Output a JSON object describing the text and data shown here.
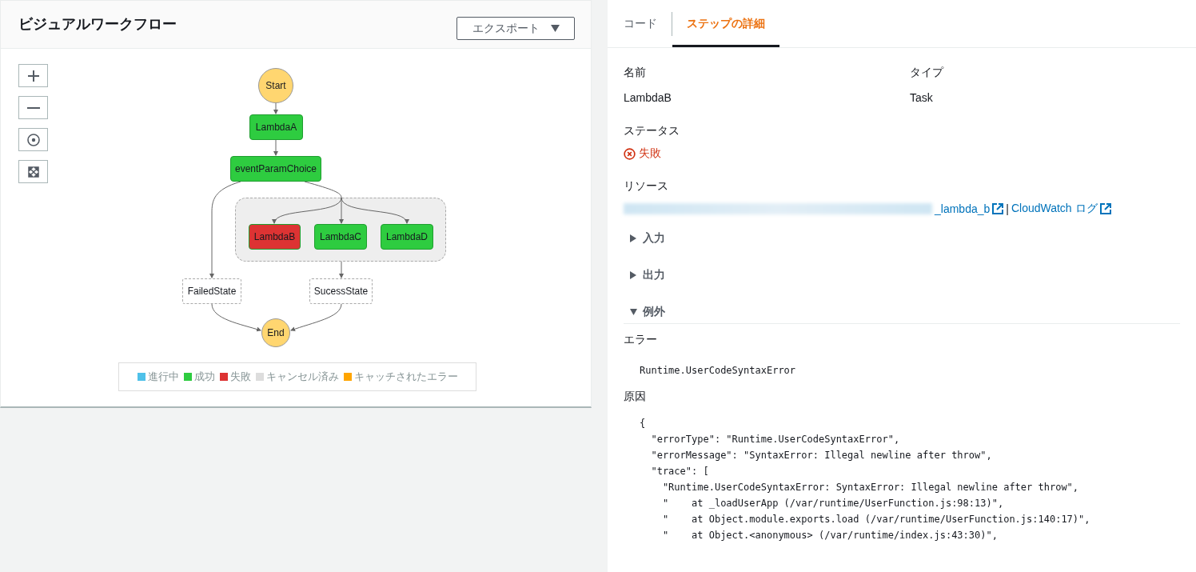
{
  "workflow": {
    "title": "ビジュアルワークフロー",
    "export_button": "エクスポート",
    "zoom_controls": [
      {
        "kind": "zoom-in"
      },
      {
        "kind": "zoom-out"
      },
      {
        "kind": "center"
      },
      {
        "kind": "fit"
      }
    ],
    "nodes": [
      {
        "label": "Start",
        "kind": "terminal",
        "color": "#ffd670"
      },
      {
        "label": "LambdaA",
        "kind": "task",
        "color": "#2ecc40"
      },
      {
        "label": "eventParamChoice",
        "kind": "task",
        "color": "#2ecc40"
      },
      {
        "label": "LambdaB",
        "kind": "task",
        "color": "#dd3333"
      },
      {
        "label": "LambdaC",
        "kind": "task",
        "color": "#2ecc40"
      },
      {
        "label": "LambdaD",
        "kind": "task",
        "color": "#2ecc40"
      },
      {
        "label": "FailedState",
        "kind": "pass",
        "color": "#ffffff"
      },
      {
        "label": "SucessState",
        "kind": "pass",
        "color": "#ffffff"
      },
      {
        "label": "End",
        "kind": "terminal",
        "color": "#ffd670"
      }
    ],
    "legend": [
      {
        "label": "進行中",
        "color": "#4fc1e9"
      },
      {
        "label": "成功",
        "color": "#2ecc40"
      },
      {
        "label": "失敗",
        "color": "#dd3333"
      },
      {
        "label": "キャンセル済み",
        "color": "#dddddd"
      },
      {
        "label": "キャッチされたエラー",
        "color": "#ffa500"
      }
    ]
  },
  "details": {
    "tabs": [
      {
        "label": "コード",
        "selected": false
      },
      {
        "label": "ステップの詳細",
        "selected": true
      }
    ],
    "name_label": "名前",
    "name_value": "LambdaB",
    "type_label": "タイプ",
    "type_value": "Task",
    "status_label": "ステータス",
    "status_value": "失敗",
    "failed": true,
    "resource_label": "リソース",
    "resource_link": "_lambda_b",
    "separator": "|",
    "log_link": "CloudWatch ログ",
    "sections": [
      {
        "label": "入力",
        "expanded": false
      },
      {
        "label": "出力",
        "expanded": false
      },
      {
        "label": "例外",
        "expanded": true
      }
    ],
    "error_label": "エラー",
    "error_value": "Runtime.UserCodeSyntaxError",
    "cause_label": "原因",
    "cause_lines": [
      "{",
      "  \"errorType\": \"Runtime.UserCodeSyntaxError\",",
      "  \"errorMessage\": \"SyntaxError: Illegal newline after throw\",",
      "  \"trace\": [",
      "    \"Runtime.UserCodeSyntaxError: SyntaxError: Illegal newline after throw\",",
      "    \"    at _loadUserApp (/var/runtime/UserFunction.js:98:13)\",",
      "    \"    at Object.module.exports.load (/var/runtime/UserFunction.js:140:17)\",",
      "    \"    at Object.<anonymous> (/var/runtime/index.js:43:30)\","
    ]
  }
}
